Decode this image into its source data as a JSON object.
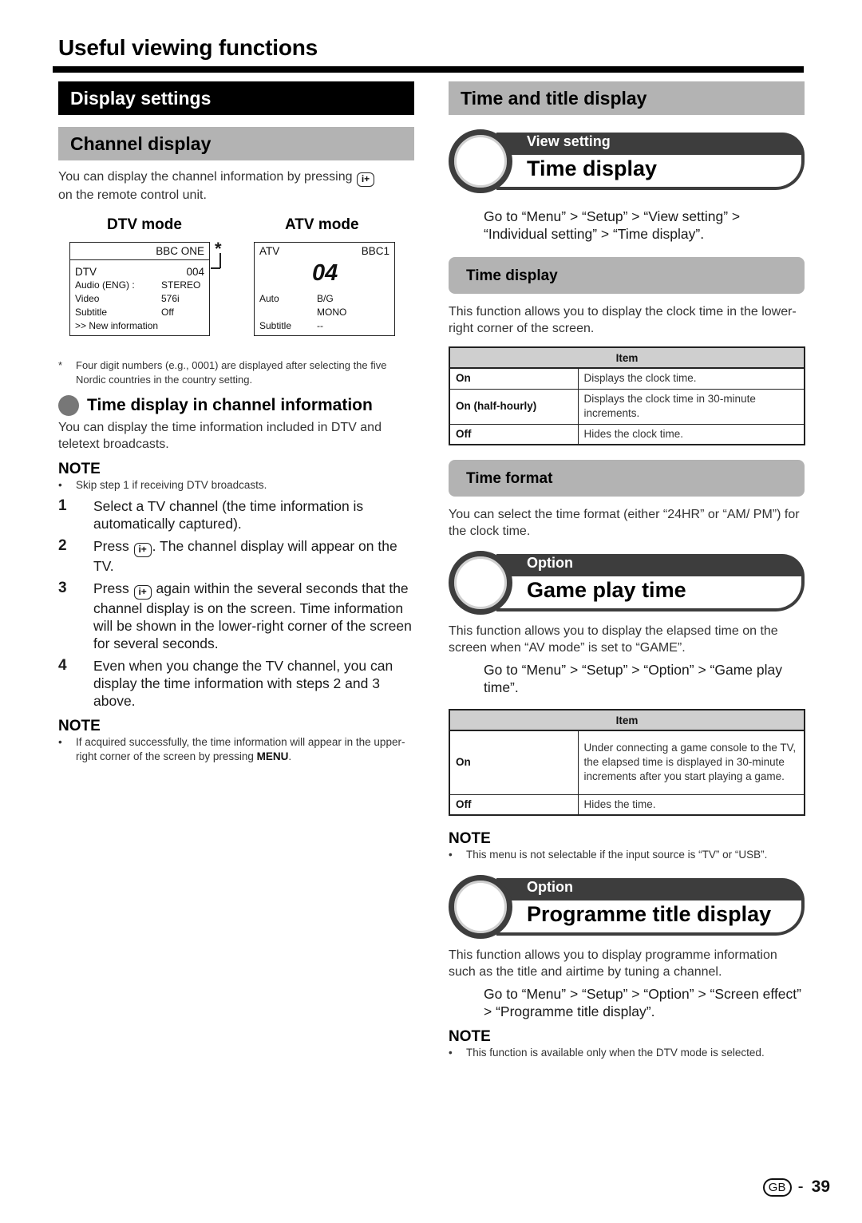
{
  "page": {
    "title": "Useful viewing functions",
    "page_region": "GB",
    "page_number": "39",
    "separator": "-"
  },
  "left": {
    "section_title": "Display settings",
    "subsection_title": "Channel display",
    "intro_before": "You can display the channel information by pressing",
    "intro_after": "on the remote control unit.",
    "info_key_label": "i+",
    "dtv": {
      "label": "DTV mode",
      "channel_name": "BBC ONE",
      "mode": "DTV",
      "number": "004",
      "asterisk": "*",
      "rows": [
        {
          "key": "Audio (ENG)  :",
          "value": "STEREO"
        },
        {
          "key": "Video",
          "value": "576i"
        },
        {
          "key": "Subtitle",
          "value": "Off"
        }
      ],
      "new_info": ">> New information"
    },
    "atv": {
      "label": "ATV mode",
      "mode": "ATV",
      "channel_name": "BBC1",
      "number": "04",
      "rows": [
        {
          "key": "Auto",
          "value": "B/G"
        },
        {
          "key": "",
          "value": "MONO"
        },
        {
          "key": "Subtitle",
          "value": "--"
        }
      ]
    },
    "footnote_mark": "*",
    "footnote": "Four digit numbers (e.g., 0001) are displayed after selecting the five Nordic countries in the country setting.",
    "time_info": {
      "heading": "Time display in channel information",
      "intro": "You can display the time information included in DTV and teletext broadcasts.",
      "note_heading": "NOTE",
      "note": "Skip step 1 if receiving DTV broadcasts.",
      "steps": [
        {
          "num": "1",
          "text": "Select a TV channel (the time information is automatically captured)."
        },
        {
          "num": "2",
          "before": "Press",
          "after": ". The channel display will appear on the TV."
        },
        {
          "num": "3",
          "before": "Press",
          "after": "again within the several seconds that the channel display is on the screen. Time information will be shown in the lower-right corner of the screen for several seconds."
        },
        {
          "num": "4",
          "text": "Even when you change the TV channel, you can display the time information with steps 2 and 3 above."
        }
      ],
      "note2_heading": "NOTE",
      "note2_before": "If acquired successfully, the time information will appear in the upper-right corner of the screen by pressing",
      "note2_key": "MENU",
      "note2_after": "."
    }
  },
  "right": {
    "section_title": "Time and title display",
    "time_display": {
      "category": "View setting",
      "title": "Time display",
      "goto": "Go to “Menu” > “Setup” > “View setting” > “Individual setting” > “Time display”.",
      "sub1_title": "Time display",
      "sub1_desc": "This function allows you to display the clock time in the lower-right corner of the screen.",
      "table_header": "Item",
      "table": [
        {
          "item": "On",
          "desc": "Displays the clock time."
        },
        {
          "item": "On (half-hourly)",
          "desc": "Displays the clock time in 30-minute increments."
        },
        {
          "item": "Off",
          "desc": "Hides the clock time."
        }
      ],
      "sub2_title": "Time format",
      "sub2_desc": "You can select the time format (either “24HR” or “AM/ PM”) for the clock time."
    },
    "game_play": {
      "category": "Option",
      "title": "Game play time",
      "desc": "This function allows you to display the elapsed time on the screen when “AV mode” is set to “GAME”.",
      "goto": "Go to “Menu” > “Setup” > “Option” > “Game play time”.",
      "table_header": "Item",
      "table": [
        {
          "item": "On",
          "desc": "Under connecting a game console to the TV, the elapsed time is displayed in 30-minute increments after you start playing a game."
        },
        {
          "item": "Off",
          "desc": "Hides the time."
        }
      ],
      "note_heading": "NOTE",
      "note": "This menu is not selectable if the input source is “TV” or “USB”."
    },
    "programme_title": {
      "category": "Option",
      "title": "Programme title display",
      "desc": "This function allows you to display programme information such as the title and airtime by tuning a channel.",
      "goto": "Go to “Menu” > “Setup” > “Option” > “Screen effect” > “Programme title display”.",
      "note_heading": "NOTE",
      "note": "This function is available only when the DTV mode is selected."
    }
  }
}
